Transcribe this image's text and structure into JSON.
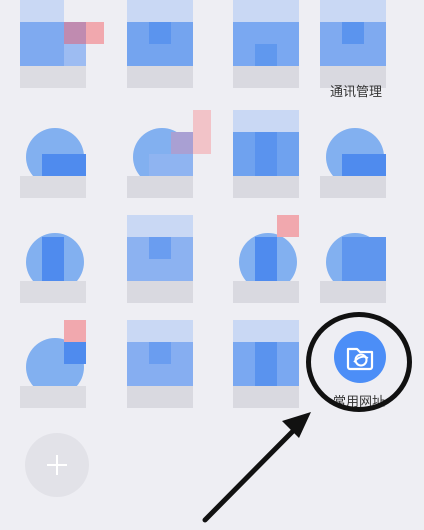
{
  "apps": {
    "row1_col4_label": "通讯管理",
    "target_label": "常用网址",
    "target_icon": "folder-browser-icon",
    "add_icon": "plus-icon"
  },
  "colors": {
    "background": "#eeeef3",
    "app_blue": "#4c8ef7",
    "highlight_ring": "#111111"
  }
}
